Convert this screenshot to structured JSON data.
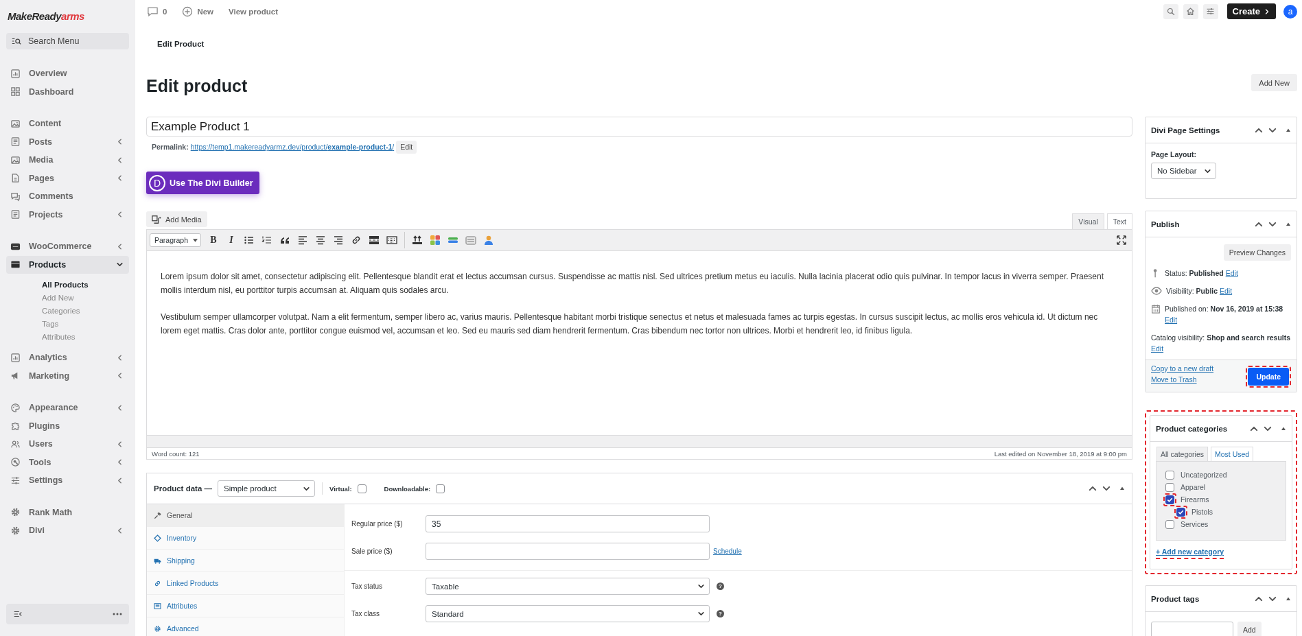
{
  "brand": {
    "name": "MakeReady",
    "accent": "arms"
  },
  "sidebar": {
    "search": {
      "placeholder": "Search Menu"
    },
    "groups": [
      [
        {
          "label": "Overview",
          "expandable": false,
          "selected": false
        },
        {
          "label": "Dashboard",
          "expandable": false,
          "selected": false
        }
      ],
      [
        {
          "label": "Content",
          "expandable": false,
          "selected": false
        },
        {
          "label": "Posts",
          "expandable": true,
          "expanded": false,
          "selected": false
        },
        {
          "label": "Media",
          "expandable": true,
          "expanded": false,
          "selected": false
        },
        {
          "label": "Pages",
          "expandable": true,
          "expanded": false,
          "selected": false
        },
        {
          "label": "Comments",
          "expandable": false,
          "selected": false
        },
        {
          "label": "Projects",
          "expandable": true,
          "expanded": false,
          "selected": false
        }
      ],
      [
        {
          "label": "WooCommerce",
          "expandable": true,
          "expanded": false,
          "selected": false
        },
        {
          "label": "Products",
          "expandable": true,
          "expanded": true,
          "selected": true,
          "children": [
            {
              "label": "All Products",
              "selected": true
            },
            {
              "label": "Add New",
              "selected": false
            },
            {
              "label": "Categories",
              "selected": false
            },
            {
              "label": "Tags",
              "selected": false
            },
            {
              "label": "Attributes",
              "selected": false
            }
          ]
        },
        {
          "label": "Analytics",
          "expandable": true,
          "expanded": false,
          "selected": false
        },
        {
          "label": "Marketing",
          "expandable": true,
          "expanded": false,
          "selected": false
        }
      ],
      [
        {
          "label": "Appearance",
          "expandable": true,
          "expanded": false,
          "selected": false
        },
        {
          "label": "Plugins",
          "expandable": false,
          "selected": false
        },
        {
          "label": "Users",
          "expandable": true,
          "expanded": false,
          "selected": false
        },
        {
          "label": "Tools",
          "expandable": true,
          "expanded": false,
          "selected": false
        },
        {
          "label": "Settings",
          "expandable": true,
          "expanded": false,
          "selected": false
        }
      ],
      [
        {
          "label": "Rank Math",
          "expandable": false,
          "selected": false
        },
        {
          "label": "Divi",
          "expandable": true,
          "expanded": false,
          "selected": false
        }
      ]
    ]
  },
  "topbar": {
    "comments": "0",
    "new": "New",
    "view": "View product",
    "create": "Create",
    "avatar": "a"
  },
  "breadcrumb": "Edit Product",
  "page_title": "Edit product",
  "add_new": "Add New",
  "product_title": "Example Product 1",
  "permalink": {
    "label": "Permalink:",
    "url": "https://temp1.makereadyarmz.dev/product/**example-product-1**/",
    "edit": "Edit"
  },
  "divi_button": {
    "badge": "D",
    "label": "Use The Divi Builder"
  },
  "editor": {
    "add_media": "Add Media",
    "tabs": [
      {
        "label": "Visual",
        "selected": true
      },
      {
        "label": "Text",
        "selected": false
      }
    ],
    "format": "Paragraph",
    "bold": "B",
    "italic": "I",
    "paragraphs": [
      "Lorem ipsum dolor sit amet, consectetur adipiscing elit. Pellentesque blandit erat et lectus accumsan cursus. Suspendisse ac mattis nisl. Sed ultrices pretium metus eu iaculis. Nulla lacinia placerat odio quis pulvinar. In tempor lacus in viverra semper. Praesent mollis interdum nisl, eu porttitor turpis accumsan at. Aliquam quis sodales arcu.",
      "Vestibulum semper ullamcorper volutpat. Nam a elit fermentum, semper libero ac, varius mauris. Pellentesque habitant morbi tristique senectus et netus et malesuada fames ac turpis egestas. In cursus suscipit lectus, ac mollis eros vehicula id. Ut dictum nec lorem eget mattis. Cras dolor ante, porttitor congue euismod vel, accumsan et leo. Sed eu mauris sed diam hendrerit fermentum. Cras bibendum nec tortor non ultrices. Morbi et hendrerit leo, id finibus ligula."
    ],
    "word_count": "Word count: 121",
    "last_edited": "Last edited on November 18, 2019 at 9:00 pm"
  },
  "product_data": {
    "title": "Product data —",
    "type": "Simple product",
    "virtual": {
      "label": "Virtual:",
      "checked": false
    },
    "downloadable": {
      "label": "Downloadable:",
      "checked": false
    },
    "tabs": [
      {
        "label": "General",
        "selected": true
      },
      {
        "label": "Inventory",
        "selected": false
      },
      {
        "label": "Shipping",
        "selected": false
      },
      {
        "label": "Linked Products",
        "selected": false
      },
      {
        "label": "Attributes",
        "selected": false
      },
      {
        "label": "Advanced",
        "selected": false
      }
    ],
    "field_groups": [
      [
        {
          "kind": "text",
          "label": "Regular price ($)",
          "value": "35"
        },
        {
          "kind": "text",
          "label": "Sale price ($)",
          "link": "Schedule"
        }
      ],
      [
        {
          "kind": "select",
          "label": "Tax status",
          "value": "Taxable",
          "help": "?"
        },
        {
          "kind": "select",
          "label": "Tax class",
          "value": "Standard",
          "help": "?"
        }
      ]
    ]
  },
  "divi_settings": {
    "title": "Divi Page Settings",
    "layout_label": "Page Layout:",
    "layout": "No Sidebar"
  },
  "publish": {
    "title": "Publish",
    "preview": "Preview Changes",
    "rows": [
      {
        "text": "Status: **Published**",
        "edit": "Edit"
      },
      {
        "text": "Visibility: **Public**",
        "edit": "Edit"
      },
      {
        "text": "Published on: **Nov 16, 2019 at 15:38**",
        "edit": "Edit"
      },
      {
        "text": "Catalog visibility: **Shop and search results**",
        "edit": "Edit"
      }
    ],
    "copy": "Copy to a new draft",
    "trash": "Move to Trash",
    "update": {
      "label": "Update",
      "highlighted": true
    }
  },
  "product_categories": {
    "title": "Product categories",
    "highlighted": true,
    "tabs": [
      {
        "label": "All categories",
        "selected": true
      },
      {
        "label": "Most Used",
        "selected": false
      }
    ],
    "items": [
      {
        "label": "Uncategorized",
        "checked": false,
        "highlighted": false
      },
      {
        "label": "Apparel",
        "checked": false,
        "highlighted": false
      },
      {
        "label": "Firearms",
        "checked": true,
        "highlighted": true,
        "children": [
          {
            "label": "Pistols",
            "checked": true,
            "highlighted": true
          }
        ]
      },
      {
        "label": "Services",
        "checked": false,
        "highlighted": false
      }
    ],
    "add_link": {
      "label": "+ Add new category",
      "highlighted": true
    }
  },
  "product_tags": {
    "title": "Product tags",
    "add": "Add"
  }
}
